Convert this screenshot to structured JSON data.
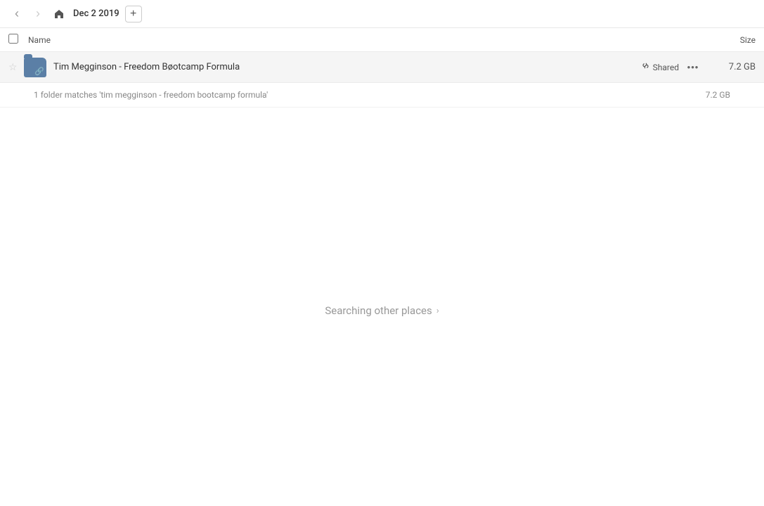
{
  "toolbar": {
    "breadcrumb": "Dec 2 2019",
    "add_button_label": "+"
  },
  "columns": {
    "name_label": "Name",
    "size_label": "Size"
  },
  "file_row": {
    "name": "Tim Megginson - Freedom Bøotcamp Formula",
    "shared_label": "Shared",
    "size": "7.2 GB",
    "more_icon": "···"
  },
  "search_info": {
    "matches_text": "1 folder matches 'tim megginson - freedom bootcamp formula'",
    "size": "7.2 GB"
  },
  "searching": {
    "label": "Searching other places",
    "chevron": "›"
  },
  "icons": {
    "back_arrow": "‹",
    "forward_arrow": "›",
    "home": "⌂",
    "star_empty": "☆",
    "link": "🔗",
    "more": "•••",
    "chevron_right": "›"
  }
}
